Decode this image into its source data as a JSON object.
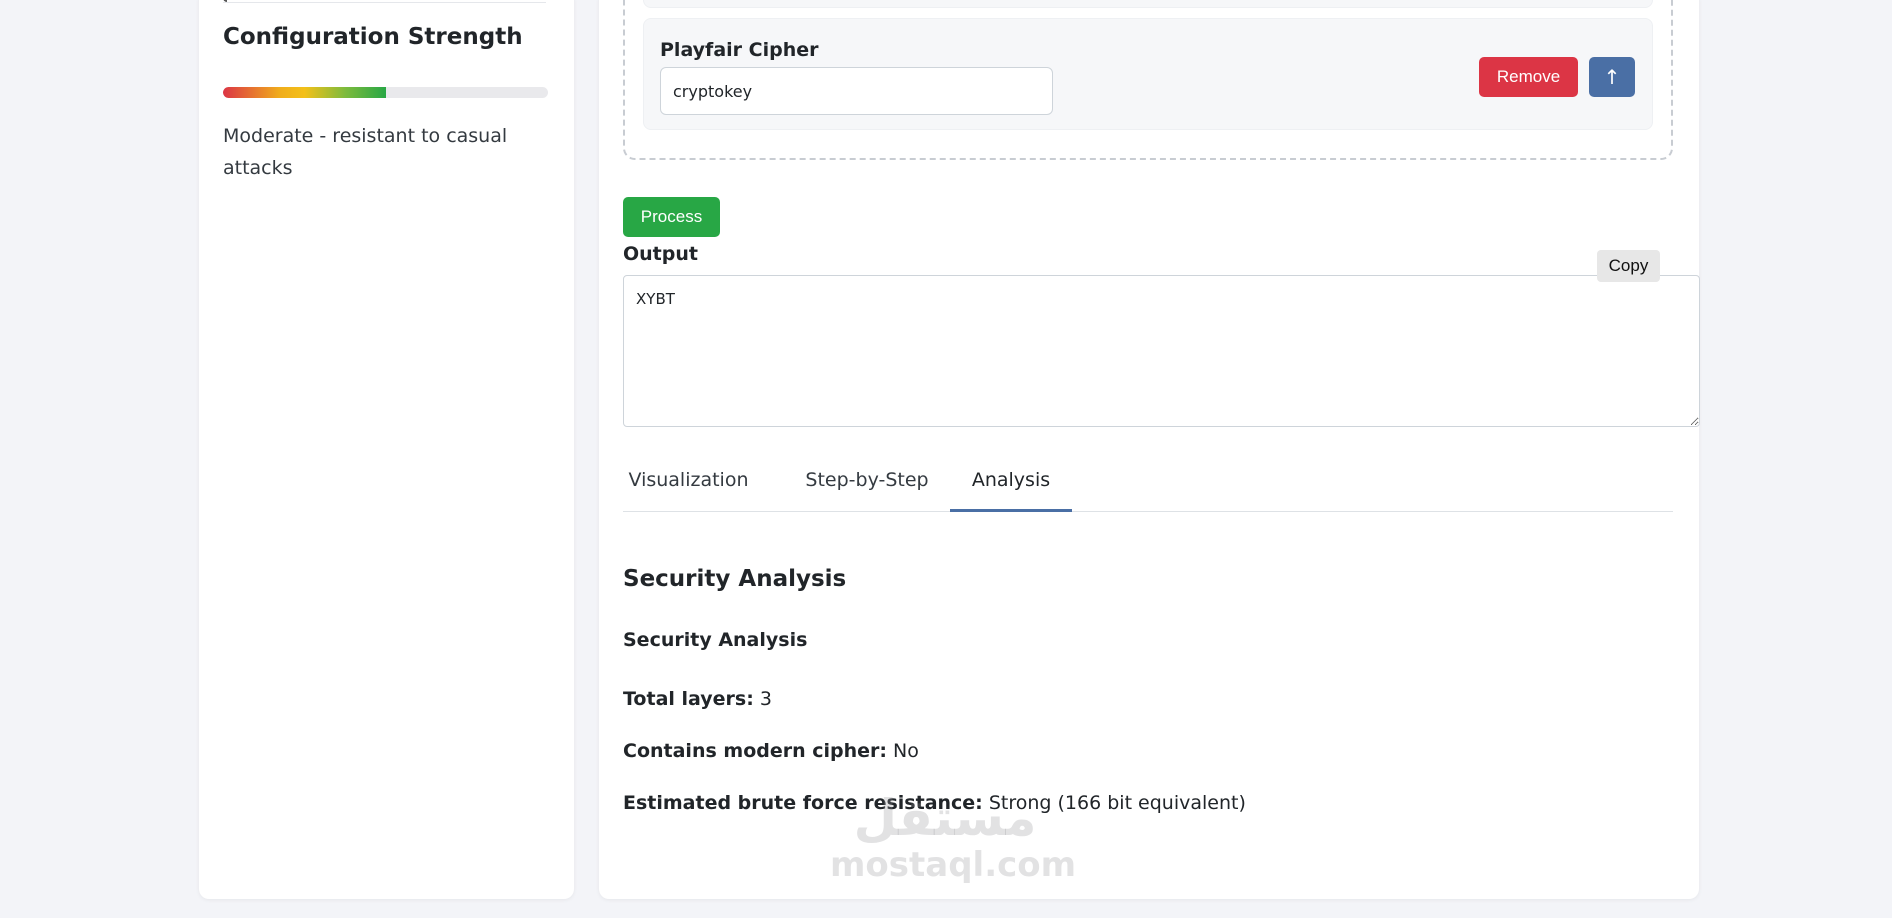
{
  "sidebar": {
    "title": "Configuration Strength",
    "strength": {
      "fraction": 0.5,
      "description": "Moderate - resistant to casual attacks"
    }
  },
  "layers": {
    "current": {
      "name": "Playfair Cipher",
      "key": "cryptokey",
      "remove_label": "Remove",
      "move_up_label": "↑"
    }
  },
  "process_label": "Process",
  "output": {
    "label": "Output",
    "copy_label": "Copy",
    "value": "XYBT"
  },
  "tabs": [
    {
      "label": "Visualization",
      "active": false
    },
    {
      "label": "Step-by-Step",
      "active": false
    },
    {
      "label": "Analysis",
      "active": true
    }
  ],
  "analysis": {
    "title": "Security Analysis",
    "subtitle": "Security Analysis",
    "stats": [
      {
        "label": "Total layers:",
        "value": "3"
      },
      {
        "label": "Contains modern cipher:",
        "value": "No"
      },
      {
        "label": "Estimated brute force resistance:",
        "value": "Strong (166 bit equivalent)"
      }
    ]
  },
  "watermark": {
    "arabic": "مستقل",
    "latin": "mostaql.com"
  },
  "colors": {
    "remove": "#dc3545",
    "move_up": "#4a6fa5",
    "process": "#28a745",
    "active_tab": "#4a6fa5"
  }
}
